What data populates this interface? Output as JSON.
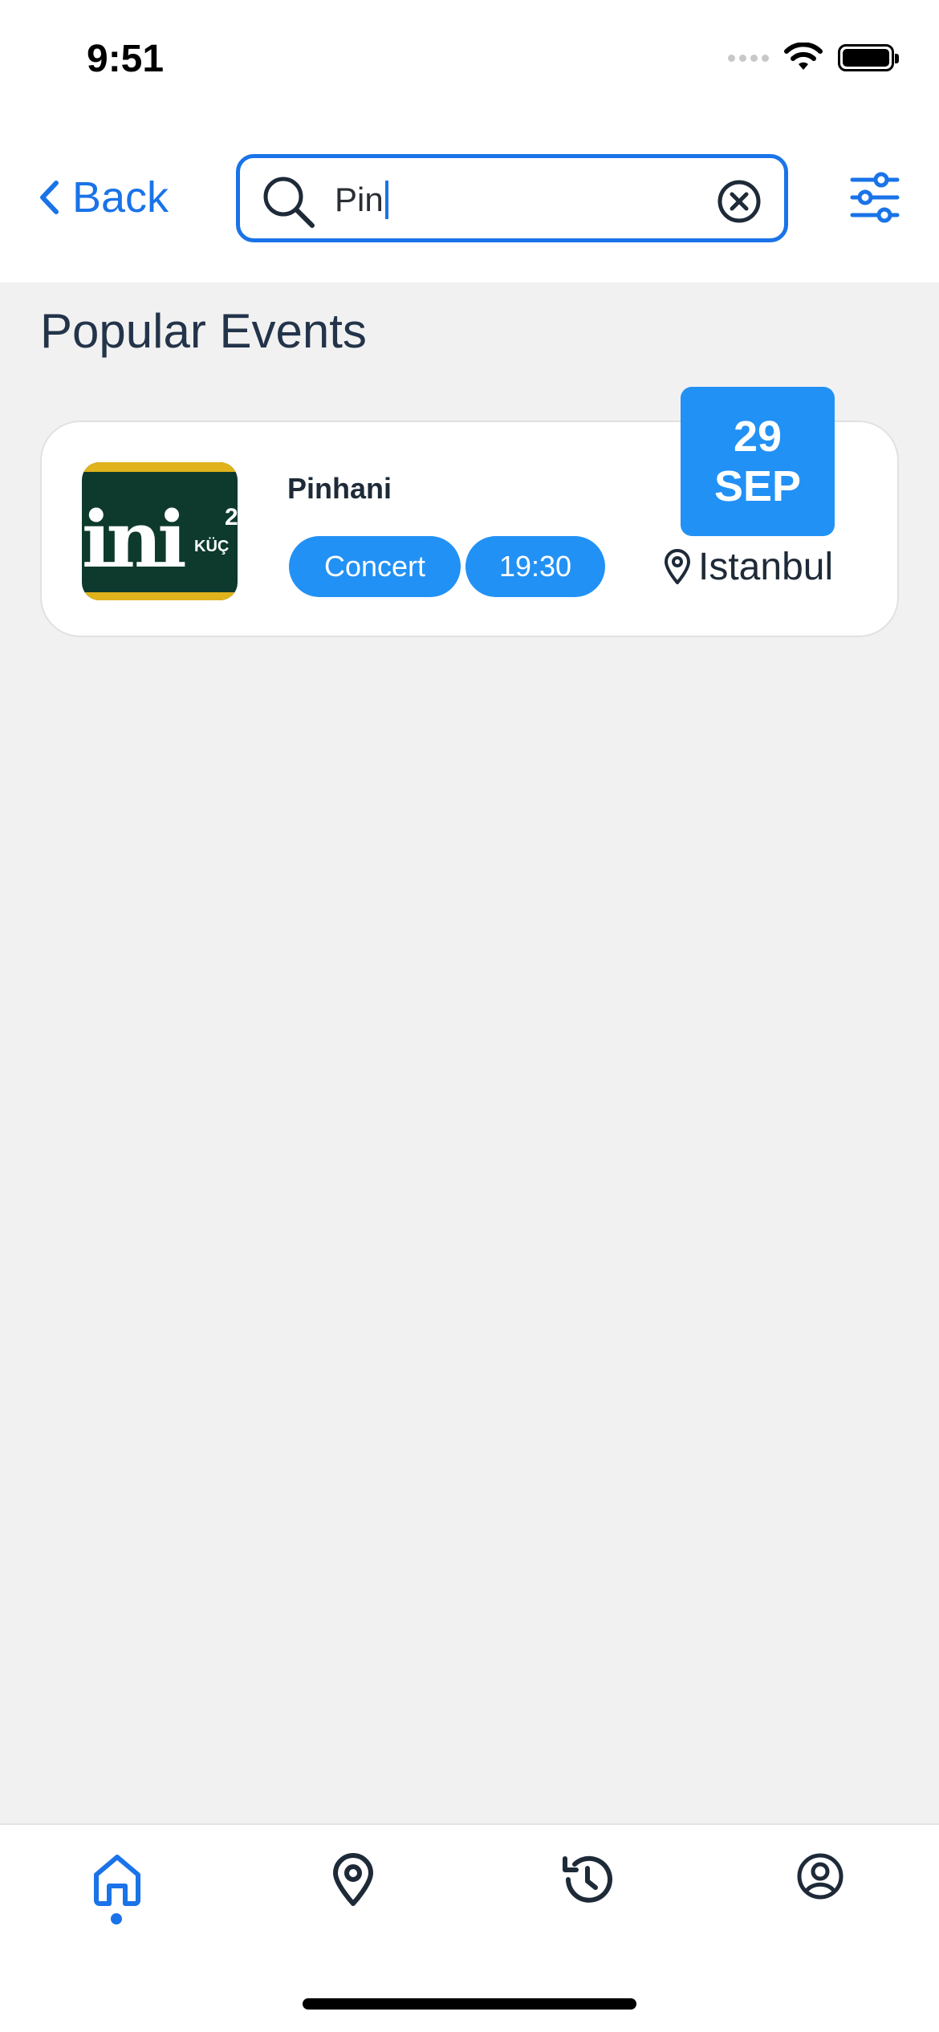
{
  "status_bar": {
    "time": "9:51"
  },
  "header": {
    "back_label": "Back",
    "search_value": "Pin"
  },
  "section": {
    "title": "Popular Events"
  },
  "events": [
    {
      "name": "Pinhani",
      "category": "Concert",
      "time": "19:30",
      "location": "Istanbul",
      "date_day": "29",
      "date_month": "SEP",
      "thumb_text": "KÜÇ",
      "thumb_num": "2"
    }
  ],
  "tab_bar": {
    "items": [
      "home",
      "location",
      "history",
      "profile"
    ],
    "active": "home"
  },
  "colors": {
    "accent": "#1a73e8",
    "tag": "#2291f5",
    "background": "#f1f1f1",
    "text": "#1d2b3a"
  },
  "icons": [
    "back-chevron-icon",
    "search-icon",
    "clear-icon",
    "filter-icon",
    "map-pin-icon",
    "home-icon",
    "location-icon",
    "history-icon",
    "profile-icon"
  ]
}
